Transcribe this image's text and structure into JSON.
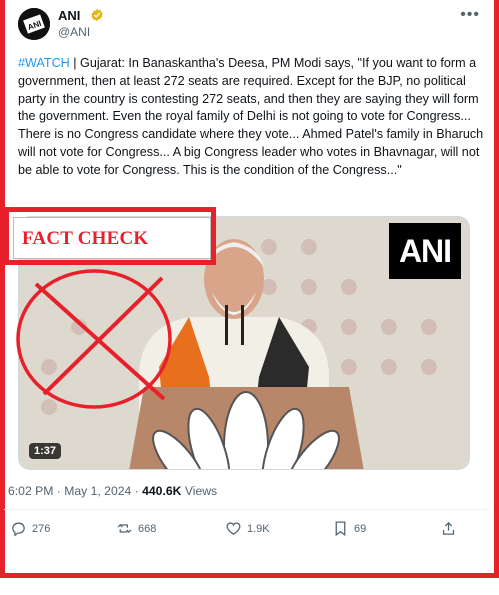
{
  "account": {
    "name": "ANI",
    "handle": "@ANI",
    "avatar_text": "ANI"
  },
  "tweet": {
    "hashtag": "#WATCH",
    "text": " | Gujarat: In Banaskantha's Deesa, PM Modi says, \"If you want to form a government, then at least 272 seats are required. Except for the BJP, no political party in the country is contesting 272 seats, and then they are saying they will form the government. Even the royal family of Delhi is not going to vote for Congress... There is no Congress candidate where they vote... Ahmed Patel's family in Bharuch will not vote for Congress... A big Congress leader who votes in Bhavnagar, will not be able to vote for Congress. This is the condition of the Congress...\""
  },
  "media": {
    "logo_text": "ANI",
    "duration": "1:37"
  },
  "overlay": {
    "fact_check_label": "FACT CHECK"
  },
  "meta": {
    "time": "6:02 PM · May 1, 2024 · ",
    "views_count": "440.6K",
    "views_label": " Views"
  },
  "actions": {
    "replies": "276",
    "reposts": "668",
    "likes": "1.9K",
    "bookmarks": "69"
  },
  "colors": {
    "accent": "#1d9bf0",
    "stamp_red": "#e8202a",
    "verified_gold": "#e2b719"
  },
  "icons": [
    "more-icon",
    "verified-badge-icon",
    "reply-icon",
    "repost-icon",
    "like-icon",
    "bookmark-icon",
    "share-icon"
  ]
}
